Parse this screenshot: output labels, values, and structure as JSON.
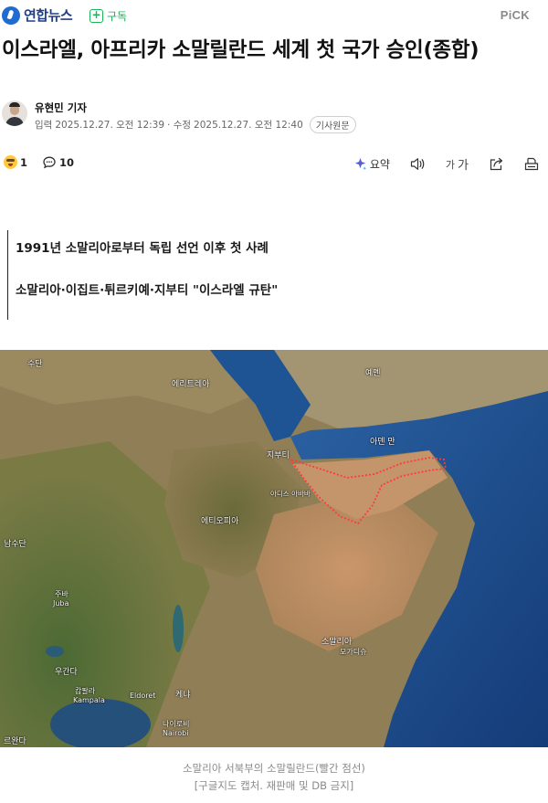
{
  "header": {
    "brand": "연합뉴스",
    "subscribe_label": "구독",
    "pick_label": "PiCK"
  },
  "article": {
    "headline": "이스라엘, 아프리카 소말릴란드 세계 첫 국가 승인(종합)",
    "reporter": "유현민 기자",
    "input_label": "입력",
    "input_date": "2025.12.27. 오전 12:39",
    "modified_label": "· 수정",
    "modified_date": "2025.12.27. 오전 12:40",
    "original_badge": "기사원문"
  },
  "actions": {
    "reaction_count": "1",
    "comment_count": "10",
    "summary_label": "요약",
    "font_label_small": "가",
    "font_label_large": "가"
  },
  "summary": {
    "line1": "1991년 소말리아로부터 독립 선언 이후 첫 사례",
    "line2": "소말리아·이집트·튀르키예·지부티 \"이스라엘 규탄\""
  },
  "map_labels": {
    "sudan": "수단",
    "eritrea": "에리트레아",
    "yemen": "예멘",
    "gulf_of_aden": "아덴 만",
    "djibouti": "지부티",
    "addis_ababa": "아디스\n아바바",
    "ethiopia": "에티오피아",
    "south_sudan": "남수단",
    "juba_ko": "주바",
    "juba_en": "Juba",
    "somalia": "소말리아",
    "mogadishu": "모가디슈",
    "uganda": "우간다",
    "kampala_ko": "캄팔라",
    "kampala_en": "Kampala",
    "eldoret": "Eldoret",
    "kenya": "케냐",
    "nairobi_ko": "나이로비",
    "nairobi_en": "Nairobi",
    "rwanda": "르완다"
  },
  "caption": {
    "line1": "소말리아 서북부의 소말릴란드(빨간 점선)",
    "line2": "[구글지도 캡처. 재판매 및 DB 금지]"
  },
  "colors": {
    "brand_blue": "#1f3f86",
    "subscribe_green": "#1bb35a",
    "border_red_dotted": "#ff3b3b",
    "sea": "#1f4f8c",
    "land_desert": "#b98d5c",
    "land_green": "#5f6e3a"
  },
  "icons": [
    "brand-logo-icon",
    "plus-icon",
    "laughing-emoji-icon",
    "comment-icon",
    "sparkle-icon",
    "speaker-icon",
    "share-icon",
    "print-icon"
  ]
}
